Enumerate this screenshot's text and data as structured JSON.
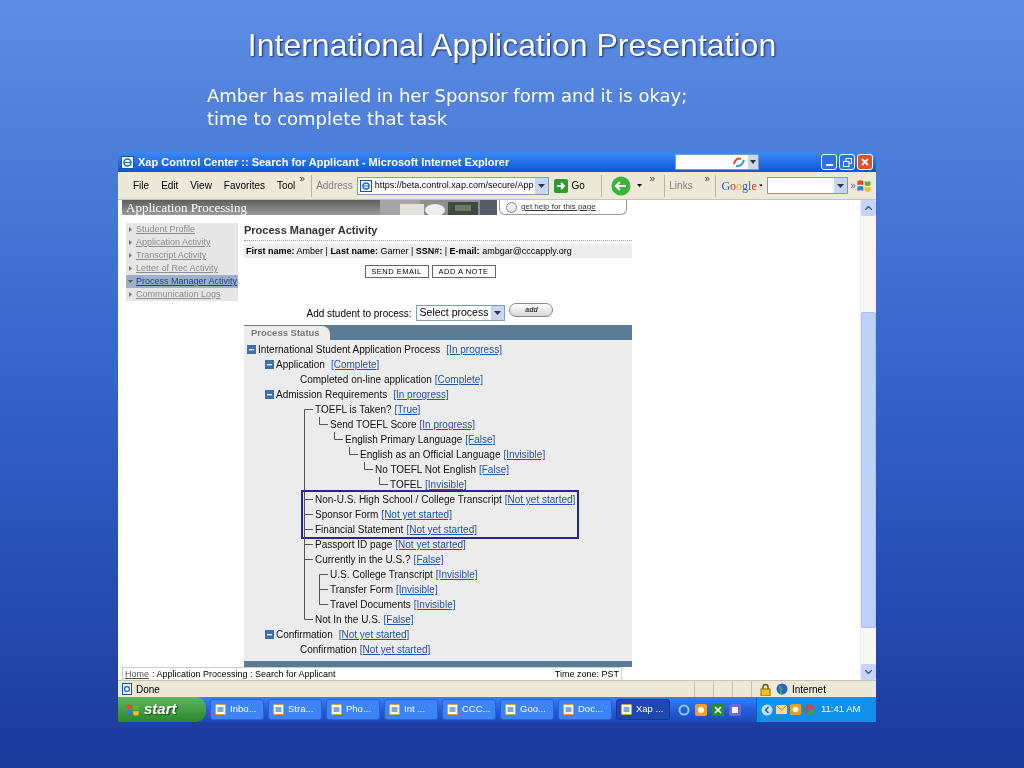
{
  "slide": {
    "title": "International Application Presentation",
    "subtitle": "Amber has mailed in her Sponsor form and it is okay; time to complete that task"
  },
  "browser": {
    "title": "Xap Control Center :: Search for Applicant - Microsoft Internet Explorer",
    "menu": [
      "File",
      "Edit",
      "View",
      "Favorites",
      "Tool"
    ],
    "address_label": "Address",
    "address": "https://beta.control.xap.com/secure/App",
    "go": "Go",
    "links": "Links",
    "google": "Google",
    "status": "Done",
    "zone": "Internet"
  },
  "page": {
    "banner": "Application Processing",
    "help_link": "get help for this page",
    "sidebar": [
      {
        "label": "Student Profile",
        "selected": false
      },
      {
        "label": "Application Activity",
        "selected": false
      },
      {
        "label": "Transcript Activity",
        "selected": false
      },
      {
        "label": "Letter of Rec Activity",
        "selected": false
      },
      {
        "label": "Process Manager Activity",
        "selected": true
      },
      {
        "label": "Communication Logs",
        "selected": false
      }
    ],
    "heading": "Process Manager Activity",
    "info": "**First name:** Amber | **Last name:** Garner | **SSN#:**  | **E-mail:** ambgar@cccapply.org",
    "buttons": [
      "SEND EMAIL",
      "ADD A NOTE"
    ],
    "add_label": "Add student to process:",
    "select": "Select process",
    "add_button": "add",
    "panel_tab": "Process Status",
    "tree": [
      {
        "label": "International Student Application Process",
        "status": "[In progress]",
        "expanded": true,
        "children": [
          {
            "label": "Application",
            "status": "[Complete]",
            "expanded": true,
            "children": [
              {
                "label": "Completed on-line application",
                "status": "[Complete]"
              }
            ]
          },
          {
            "label": "Admission Requirements",
            "status": "[In progress]",
            "expanded": true,
            "tree_lines": true,
            "children": [
              {
                "label": "TOEFL is Taken?",
                "status": "[True]",
                "highlighted": false,
                "children": [
                  {
                    "label": "Send TOEFL Score",
                    "status": "[In progress]",
                    "children": [
                      {
                        "label": "English Primary Language",
                        "status": "[False]",
                        "children": [
                          {
                            "label": "English as an Official Language",
                            "status": "[Invisible]",
                            "children": [
                              {
                                "label": "No TOEFL Not English",
                                "status": "[False]",
                                "children": [
                                  {
                                    "label": "TOFEL",
                                    "status": "[Invisible]"
                                  }
                                ]
                              }
                            ]
                          }
                        ]
                      }
                    ]
                  }
                ]
              },
              {
                "label": "Non-U.S. High School / College Transcript",
                "status": "[Not yet started]",
                "highlighted": true
              },
              {
                "label": "Sponsor Form",
                "status": "[Not yet started]",
                "highlighted": true
              },
              {
                "label": "Financial Statement",
                "status": "[Not yet started]",
                "highlighted": true
              },
              {
                "label": "Passport ID page",
                "status": "[Not yet started]",
                "highlighted": false
              },
              {
                "label": "Currently in the U.S.?",
                "status": "[False]",
                "highlighted": false,
                "children": [
                  {
                    "label": "U.S. College Transcript",
                    "status": "[Invisible]"
                  },
                  {
                    "label": "Transfer Form",
                    "status": "[Invisible]"
                  },
                  {
                    "label": "Travel Documents",
                    "status": "[Invisible]"
                  }
                ]
              },
              {
                "label": "Not In the U.S.",
                "status": "[False]",
                "highlighted": false
              }
            ]
          },
          {
            "label": "Confirmation",
            "status": "[Not yet started]",
            "expanded": true,
            "children": [
              {
                "label": "Confirmation",
                "status": "[Not yet started]"
              }
            ]
          }
        ]
      }
    ],
    "breadcrumb_home": "Home",
    "breadcrumb_trail": ": Application Processing : Search for Applicant",
    "timezone": "Time zone: PST"
  },
  "taskbar": {
    "start": "start",
    "tasks": [
      {
        "label": "Inbo...",
        "selected": false
      },
      {
        "label": "Stra...",
        "selected": false
      },
      {
        "label": "Pho...",
        "selected": false
      },
      {
        "label": "Int ...",
        "selected": false
      },
      {
        "label": "CCC...",
        "selected": false
      },
      {
        "label": "Goo...",
        "selected": false
      },
      {
        "label": "Doc...",
        "selected": false
      },
      {
        "label": "Xap ...",
        "selected": true
      }
    ],
    "clock": "11:41 AM"
  }
}
